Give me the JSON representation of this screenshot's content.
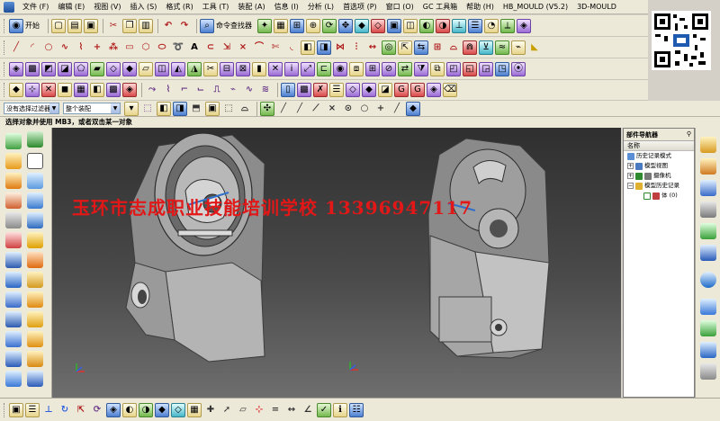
{
  "menu": {
    "items": [
      "文件 (F)",
      "编辑 (E)",
      "视图 (V)",
      "插入 (S)",
      "格式 (R)",
      "工具 (T)",
      "装配 (A)",
      "信息 (I)",
      "分析 (L)",
      "首选项 (P)",
      "窗口 (O)",
      "GC 工具箱",
      "帮助 (H)",
      "HB_MOULD (V5.2)",
      "3D-MOULD"
    ]
  },
  "toolbar": {
    "start_label": "开始",
    "command_finder_label": "命令查找器"
  },
  "selection": {
    "filter_value": "没有选择过滤器",
    "scope_value": "整个装配"
  },
  "cue_line": "选择对象并使用 MB3，或者双击某一对象",
  "watermark": "玉环市志成职业技能培训学校 13396947117",
  "navigator": {
    "title": "部件导航器",
    "column_header": "名称",
    "items": [
      {
        "label": "历史记录模式"
      },
      {
        "label": "模型视图"
      },
      {
        "label": "摄像机"
      },
      {
        "label": "模型历史记录"
      },
      {
        "label": "体 (0)"
      }
    ]
  },
  "colors": {
    "accent": "#e21818",
    "chrome": "#ece9d8",
    "viewport_top": "#2f2f2f",
    "viewport_bottom": "#6e6e6e"
  }
}
